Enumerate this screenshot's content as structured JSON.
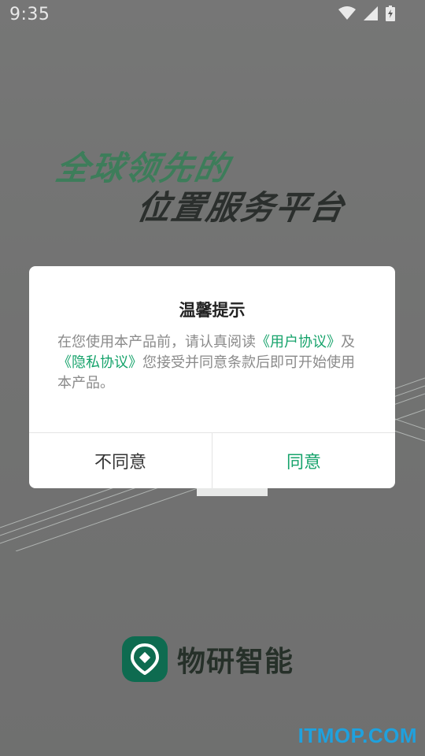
{
  "status_bar": {
    "time": "9:35",
    "icons": [
      "wifi-icon",
      "signal-icon",
      "battery-icon"
    ]
  },
  "background": {
    "slogan_line1": "全球领先的",
    "slogan_line2": "位置服务平台",
    "brand_name": "物研智能",
    "watermark": "ITMOP.COM"
  },
  "dialog": {
    "title": "温馨提示",
    "body_prefix": "在您使用本产品前，请认真阅读",
    "link_user_agreement": "《用户协议》",
    "and": "及",
    "link_privacy_agreement": "《隐私协议》",
    "body_suffix": "您接受并同意条款后即可开始使用本产品。",
    "disagree_label": "不同意",
    "agree_label": "同意"
  },
  "colors": {
    "accent": "#16a36b",
    "brand": "#0e6b50",
    "watermark": "#1fa1de"
  }
}
